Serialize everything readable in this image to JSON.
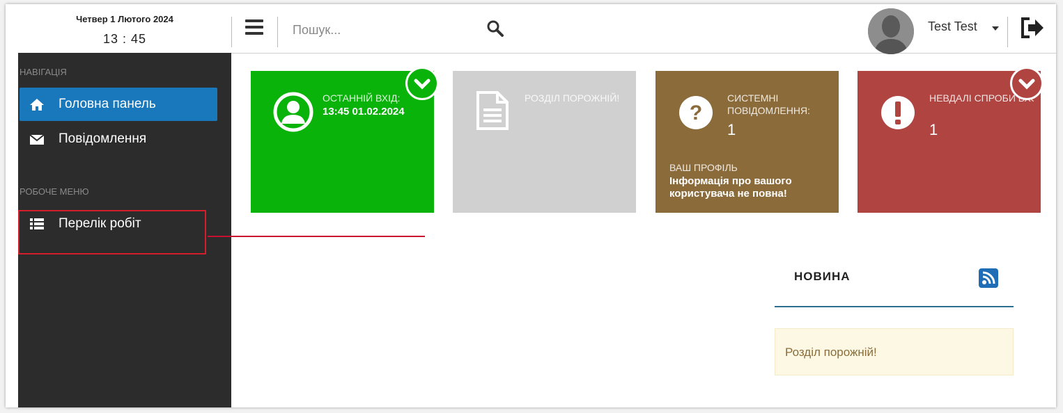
{
  "datetime": {
    "date": "Четвер 1 Лютого 2024",
    "time": "13 : 45"
  },
  "header": {
    "search_placeholder": "Пошук...",
    "user_name": "Test Test"
  },
  "sidebar": {
    "nav_section_label": "НАВІГАЦІЯ",
    "nav_items": [
      {
        "label": "Головна панель",
        "icon": "home-icon",
        "active": true
      },
      {
        "label": "Повідомлення",
        "icon": "envelope-icon",
        "active": false
      }
    ],
    "work_section_label": "РОБОЧЕ МЕНЮ",
    "work_items": [
      {
        "label": "Перелік робіт",
        "icon": "list-icon",
        "highlighted": true
      }
    ]
  },
  "tiles": [
    {
      "label": "ОСТАННІЙ ВХІД:",
      "value": "13:45 01.02.2024",
      "color": "#0ab30a",
      "icon": "user-icon"
    },
    {
      "label": "РОЗДІЛ ПОРОЖНІЙ!",
      "color": "#d0d0d0",
      "icon": "document-icon"
    },
    {
      "label": "СИСТЕМНІ ПОВІДОМЛЕННЯ:",
      "value": "1",
      "profile_label": "ВАШ ПРОФІЛЬ",
      "profile_text": "Інформація про вашого користувача не повна!",
      "color": "#8b6b3a",
      "icon": "question-icon"
    },
    {
      "label": "НЕВДАЛІ СПРОБИ ВХОДУ:",
      "value": "1",
      "color": "#b04441",
      "icon": "exclamation-icon"
    }
  ],
  "news": {
    "title": "НОВИНА",
    "empty_text": "Розділ порожній!"
  },
  "colors": {
    "sidebar_bg": "#2c2c2c",
    "active_nav": "#1977bb",
    "highlight_border": "#d41e2b"
  }
}
